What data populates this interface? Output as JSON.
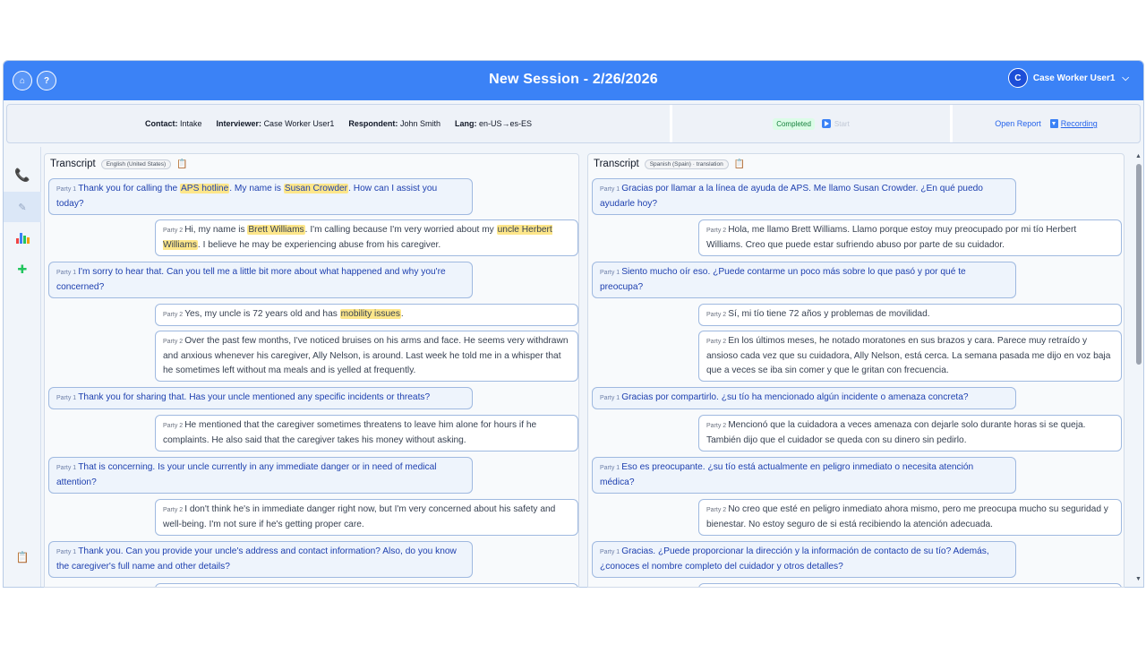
{
  "header": {
    "home_label": "⌂",
    "help_label": "?",
    "title": "New Session - 2/26/2026",
    "user_initial": "C",
    "user_name": "Case Worker User1"
  },
  "info": {
    "contact_label": "Contact:",
    "contact_value": "Intake",
    "interviewer_label": "Interviewer:",
    "interviewer_value": "Case Worker User1",
    "respondent_label": "Respondent:",
    "respondent_value": "John Smith",
    "lang_label": "Lang:",
    "lang_value": "en-US→es-ES",
    "status": "Completed",
    "start_label": "Start",
    "open_report": "Open Report",
    "recording": "Recording"
  },
  "left": {
    "title": "Transcript",
    "lang": "English (United States)",
    "messages": [
      {
        "party": "Party 1",
        "parts": [
          "Thank you for calling the ",
          "APS hotline",
          ". My name is ",
          "Susan Crowder",
          ". How can I assist you today?"
        ]
      },
      {
        "party": "Party 2",
        "parts": [
          "Hi, my name is ",
          "Brett Williams",
          ". I'm calling because I'm very worried about my ",
          "uncle Herbert Williams",
          ". I believe he may be experiencing abuse from his caregiver."
        ]
      },
      {
        "party": "Party 1",
        "parts": [
          "I'm sorry to hear that. Can you tell me a little bit more about what happened and why you're concerned?"
        ]
      },
      {
        "party": "Party 2",
        "parts": [
          "Yes, my uncle is 72 years old and has ",
          "mobility issues",
          "."
        ]
      },
      {
        "party": "Party 2",
        "parts": [
          "Over the past few months, I've noticed bruises on his arms and face. He seems very withdrawn and anxious whenever his caregiver, Ally Nelson, is around. Last week he told me in a whisper that he sometimes left without ma meals and is yelled at frequently."
        ]
      },
      {
        "party": "Party 1",
        "parts": [
          "Thank you for sharing that. Has your uncle mentioned any specific incidents or threats?"
        ]
      },
      {
        "party": "Party 2",
        "parts": [
          "He mentioned that the caregiver sometimes threatens to leave him alone for hours if he complaints. He also said that the caregiver takes his money without asking."
        ]
      },
      {
        "party": "Party 1",
        "parts": [
          "That is concerning. Is your uncle currently in any immediate danger or in need of medical attention?"
        ]
      },
      {
        "party": "Party 2",
        "parts": [
          "I don't think he's in immediate danger right now, but I'm very concerned about his safety and well-being. I'm not sure if he's getting proper care."
        ]
      },
      {
        "party": "Party 1",
        "parts": [
          "Thank you. Can you provide your uncle's address and contact information? Also, do you know the caregiver's full name and other details?"
        ]
      }
    ]
  },
  "right": {
    "title": "Transcript",
    "lang": "Spanish (Spain) · translation",
    "messages": [
      {
        "party": "Party 1",
        "text": "Gracias por llamar a la línea de ayuda de APS. Me llamo Susan Crowder. ¿En qué puedo ayudarle hoy?"
      },
      {
        "party": "Party 2",
        "text": "Hola, me llamo Brett Williams. Llamo porque estoy muy preocupado por mi tío Herbert Williams. Creo que puede estar sufriendo abuso por parte de su cuidador."
      },
      {
        "party": "Party 1",
        "text": "Siento mucho oír eso. ¿Puede contarme un poco más sobre lo que pasó y por qué te preocupa?"
      },
      {
        "party": "Party 2",
        "text": "Sí, mi tío tiene 72 años y problemas de movilidad."
      },
      {
        "party": "Party 2",
        "text": "En los últimos meses, he notado moratones en sus brazos y cara. Parece muy retraído y ansioso cada vez que su cuidadora, Ally Nelson, está cerca. La semana pasada me dijo en voz baja que a veces se iba sin comer y que le gritan con frecuencia."
      },
      {
        "party": "Party 1",
        "text": "Gracias por compartirlo. ¿su tío ha mencionado algún incidente o amenaza concreta?"
      },
      {
        "party": "Party 2",
        "text": "Mencionó que la cuidadora a veces amenaza con dejarle solo durante horas si se queja. También dijo que el cuidador se queda con su dinero sin pedirlo."
      },
      {
        "party": "Party 1",
        "text": "Eso es preocupante. ¿su tío está actualmente en peligro inmediato o necesita atención médica?"
      },
      {
        "party": "Party 2",
        "text": "No creo que esté en peligro inmediato ahora mismo, pero me preocupa mucho su seguridad y bienestar. No estoy seguro de si está recibiendo la atención adecuada."
      },
      {
        "party": "Party 1",
        "text": "Gracias. ¿Puede proporcionar la dirección y la información de contacto de su tío? Además, ¿conoces el nombre completo del cuidador y otros detalles?"
      }
    ]
  },
  "colors": {
    "header": "#3b82f6",
    "highlight": "#fde68a",
    "party1_bg": "#eef4fc",
    "status_green": "#15803d"
  },
  "icons": {
    "home": "home-icon",
    "help": "help-icon",
    "nav": [
      "phone-icon",
      "chat-icon",
      "chart-icon",
      "puzzle-icon",
      "clipboard-icon"
    ]
  }
}
